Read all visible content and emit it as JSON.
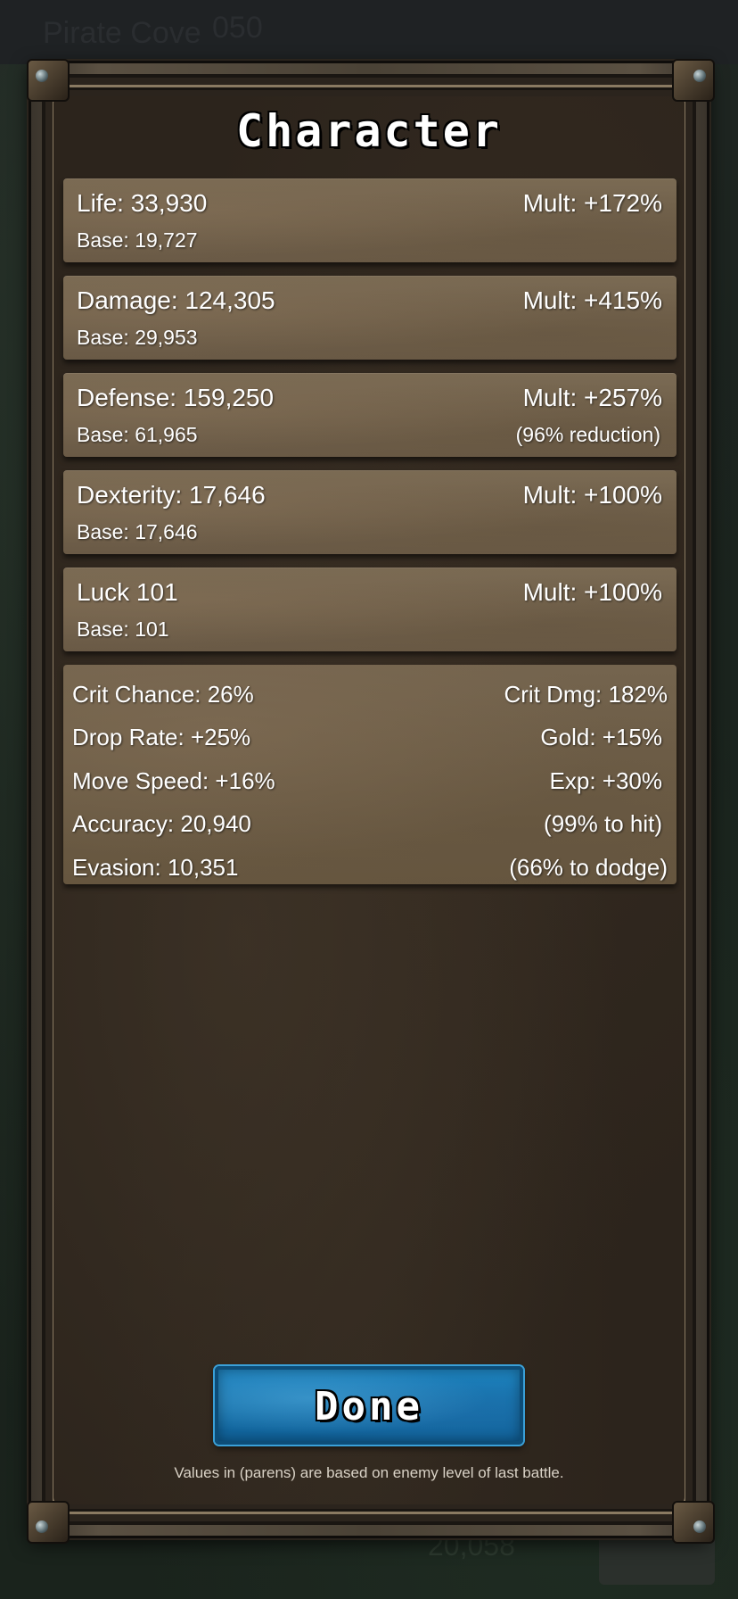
{
  "background": {
    "location": "Pirate Cove",
    "counter": "050",
    "bottom_value": "20,058"
  },
  "panel": {
    "title": "Character",
    "primary_stats": [
      {
        "label": "Life: 33,930",
        "mult": "Mult: +172%",
        "base": "Base: 19,727",
        "note": ""
      },
      {
        "label": "Damage: 124,305",
        "mult": "Mult: +415%",
        "base": "Base: 29,953",
        "note": ""
      },
      {
        "label": "Defense: 159,250",
        "mult": "Mult: +257%",
        "base": "Base: 61,965",
        "note": "(96% reduction)"
      },
      {
        "label": "Dexterity: 17,646",
        "mult": "Mult: +100%",
        "base": "Base: 17,646",
        "note": ""
      },
      {
        "label": "Luck 101",
        "mult": "Mult: +100%",
        "base": "Base: 101",
        "note": ""
      }
    ],
    "secondary_stats": [
      {
        "left": "Crit Chance: 26%",
        "right": "Crit Dmg: 182%"
      },
      {
        "left": "Drop Rate: +25%",
        "right": "Gold: +15%"
      },
      {
        "left": "Move Speed: +16%",
        "right": "Exp: +30%"
      },
      {
        "left": "Accuracy: 20,940",
        "right": "(99% to hit)"
      },
      {
        "left": "Evasion: 10,351",
        "right": "(66% to dodge)"
      }
    ],
    "done_label": "Done",
    "footer_note": "Values in (parens) are based on enemy level of last battle."
  },
  "colors": {
    "panel_bg": "#2c241c",
    "card_bg": "#74644e",
    "button_blue": "#1e83bf",
    "text": "#ffffff"
  }
}
